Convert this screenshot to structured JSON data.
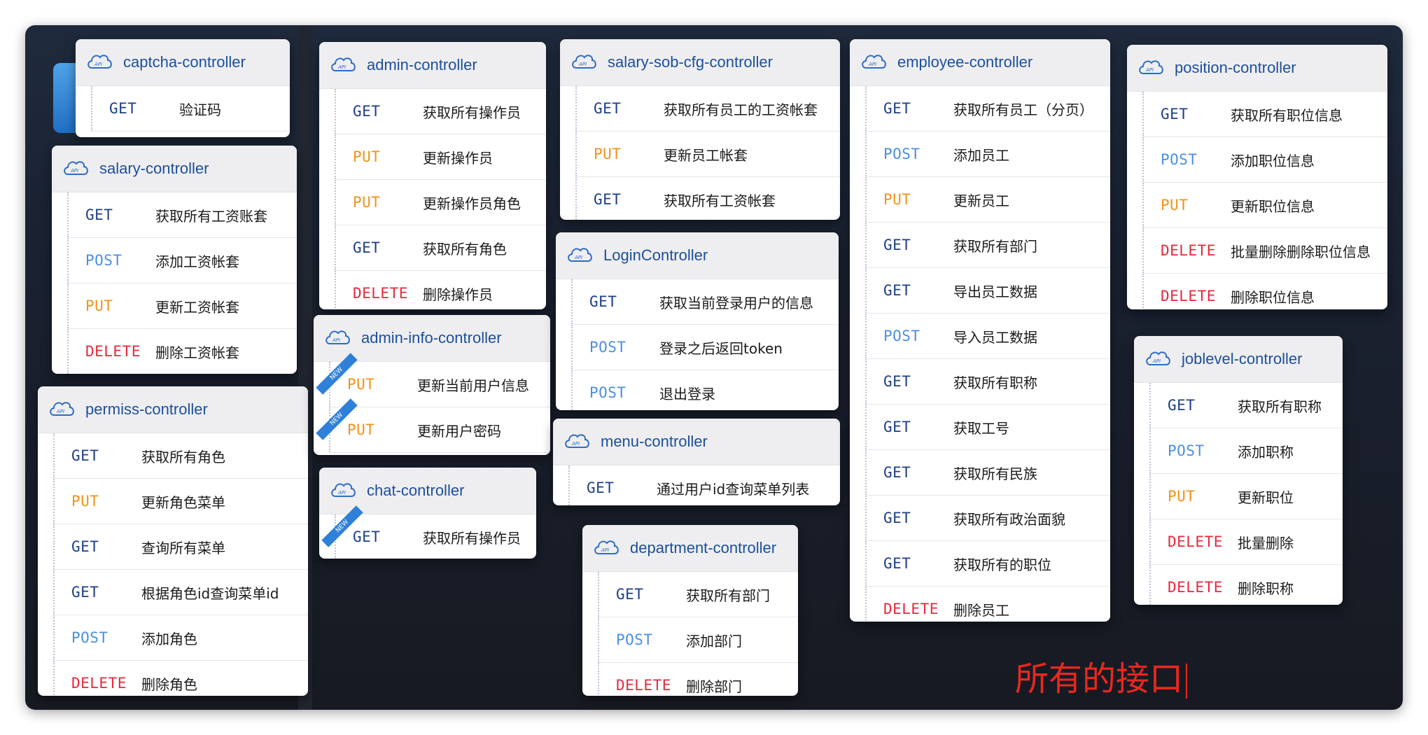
{
  "method_colors": {
    "GET": "#1f3f86",
    "POST": "#4b8fe0",
    "PUT": "#f0931a",
    "DELETE": "#e8283c"
  },
  "cards": [
    {
      "id": "captcha",
      "title": "captcha-controller",
      "rows": [
        {
          "method": "GET",
          "desc": "验证码"
        }
      ]
    },
    {
      "id": "salary",
      "title": "salary-controller",
      "rows": [
        {
          "method": "GET",
          "desc": "获取所有工资账套"
        },
        {
          "method": "POST",
          "desc": "添加工资帐套"
        },
        {
          "method": "PUT",
          "desc": "更新工资帐套"
        },
        {
          "method": "DELETE",
          "desc": "删除工资帐套"
        }
      ]
    },
    {
      "id": "permiss",
      "title": "permiss-controller",
      "rows": [
        {
          "method": "GET",
          "desc": "获取所有角色"
        },
        {
          "method": "PUT",
          "desc": "更新角色菜单"
        },
        {
          "method": "GET",
          "desc": "查询所有菜单"
        },
        {
          "method": "GET",
          "desc": "根据角色id查询菜单id"
        },
        {
          "method": "POST",
          "desc": "添加角色"
        },
        {
          "method": "DELETE",
          "desc": "删除角色"
        }
      ]
    },
    {
      "id": "admin",
      "title": "admin-controller",
      "rows": [
        {
          "method": "GET",
          "desc": "获取所有操作员"
        },
        {
          "method": "PUT",
          "desc": "更新操作员"
        },
        {
          "method": "PUT",
          "desc": "更新操作员角色"
        },
        {
          "method": "GET",
          "desc": "获取所有角色"
        },
        {
          "method": "DELETE",
          "desc": "删除操作员"
        }
      ]
    },
    {
      "id": "admin-info",
      "title": "admin-info-controller",
      "rows": [
        {
          "method": "PUT",
          "desc": "更新当前用户信息",
          "badge": "NEW"
        },
        {
          "method": "PUT",
          "desc": "更新用户密码",
          "badge": "NEW"
        }
      ]
    },
    {
      "id": "chat",
      "title": "chat-controller",
      "rows": [
        {
          "method": "GET",
          "desc": "获取所有操作员",
          "badge": "NEW"
        }
      ]
    },
    {
      "id": "salary-sob",
      "title": "salary-sob-cfg-controller",
      "rows": [
        {
          "method": "GET",
          "desc": "获取所有员工的工资帐套"
        },
        {
          "method": "PUT",
          "desc": "更新员工帐套"
        },
        {
          "method": "GET",
          "desc": "获取所有工资帐套"
        }
      ]
    },
    {
      "id": "login",
      "title": "LoginController",
      "rows": [
        {
          "method": "GET",
          "desc": "获取当前登录用户的信息"
        },
        {
          "method": "POST",
          "desc": "登录之后返回token"
        },
        {
          "method": "POST",
          "desc": "退出登录"
        }
      ]
    },
    {
      "id": "menu",
      "title": "menu-controller",
      "rows": [
        {
          "method": "GET",
          "desc": "通过用户id查询菜单列表"
        }
      ]
    },
    {
      "id": "department",
      "title": "department-controller",
      "rows": [
        {
          "method": "GET",
          "desc": "获取所有部门"
        },
        {
          "method": "POST",
          "desc": "添加部门"
        },
        {
          "method": "DELETE",
          "desc": "删除部门"
        }
      ]
    },
    {
      "id": "employee",
      "title": "employee-controller",
      "rows": [
        {
          "method": "GET",
          "desc": "获取所有员工（分页）"
        },
        {
          "method": "POST",
          "desc": "添加员工"
        },
        {
          "method": "PUT",
          "desc": "更新员工"
        },
        {
          "method": "GET",
          "desc": "获取所有部门"
        },
        {
          "method": "GET",
          "desc": "导出员工数据"
        },
        {
          "method": "POST",
          "desc": "导入员工数据"
        },
        {
          "method": "GET",
          "desc": "获取所有职称"
        },
        {
          "method": "GET",
          "desc": "获取工号"
        },
        {
          "method": "GET",
          "desc": "获取所有民族"
        },
        {
          "method": "GET",
          "desc": "获取所有政治面貌"
        },
        {
          "method": "GET",
          "desc": "获取所有的职位"
        },
        {
          "method": "DELETE",
          "desc": "删除员工"
        }
      ]
    },
    {
      "id": "position",
      "title": "position-controller",
      "rows": [
        {
          "method": "GET",
          "desc": "获取所有职位信息"
        },
        {
          "method": "POST",
          "desc": "添加职位信息"
        },
        {
          "method": "PUT",
          "desc": "更新职位信息"
        },
        {
          "method": "DELETE",
          "desc": "批量删除删除职位信息"
        },
        {
          "method": "DELETE",
          "desc": "删除职位信息"
        }
      ]
    },
    {
      "id": "joblevel",
      "title": "joblevel-controller",
      "rows": [
        {
          "method": "GET",
          "desc": "获取所有职称"
        },
        {
          "method": "POST",
          "desc": "添加职称"
        },
        {
          "method": "PUT",
          "desc": "更新职位"
        },
        {
          "method": "DELETE",
          "desc": "批量删除"
        },
        {
          "method": "DELETE",
          "desc": "删除职称"
        }
      ]
    }
  ],
  "annotation": "所有的接口"
}
